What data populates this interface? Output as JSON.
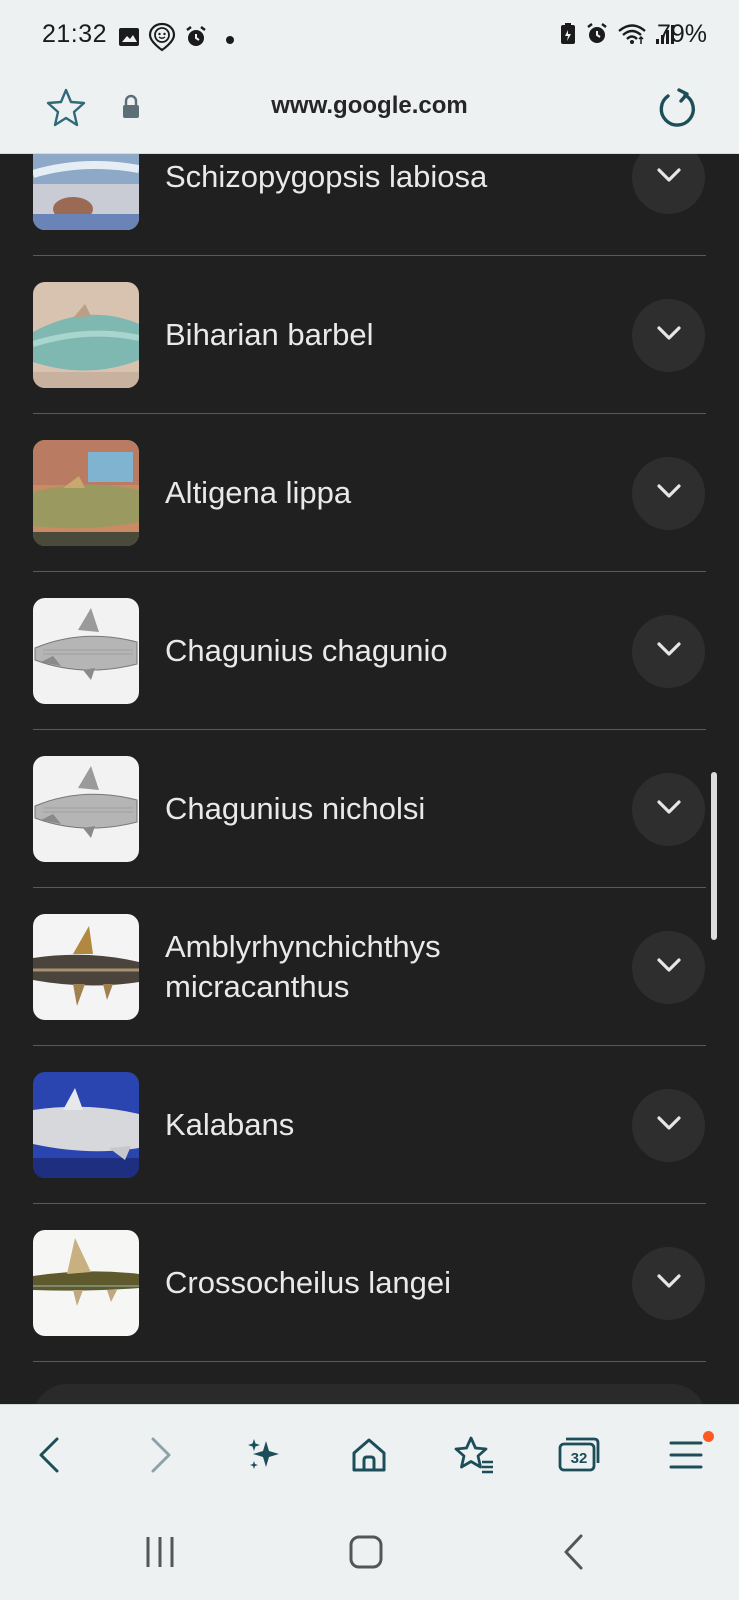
{
  "status_bar": {
    "time": "21:32",
    "battery": "79%",
    "left_icons": [
      "gallery-icon",
      "face-location-icon",
      "alarm-icon",
      "dot-icon"
    ],
    "right_icons": [
      "battery-saver-icon",
      "alarm-icon",
      "wifi-icon",
      "signal-icon",
      "battery-charging-icon"
    ]
  },
  "url_bar": {
    "url": "www.google.com"
  },
  "results": [
    {
      "label": "Schizopygopsis labiosa"
    },
    {
      "label": "Biharian barbel"
    },
    {
      "label": "Altigena lippa"
    },
    {
      "label": "Chagunius chagunio"
    },
    {
      "label": "Chagunius nicholsi"
    },
    {
      "label": "Amblyrhynchichthys micracanthus"
    },
    {
      "label": "Kalabans"
    },
    {
      "label": "Crossocheilus langei"
    }
  ],
  "toolbar": {
    "tabs_count": "32",
    "items": [
      "back-icon",
      "forward-icon",
      "ai-sparkle-icon",
      "home-icon",
      "bookmarks-icon",
      "tabs-icon",
      "menu-icon"
    ]
  },
  "nav_bar": {
    "items": [
      "recents-icon",
      "home-icon",
      "back-icon"
    ]
  },
  "colors": {
    "page_bg": "#202020",
    "chrome_bg": "#eef1f2",
    "icon_teal": "#1c4e5a",
    "divider": "#5a5a5a",
    "expand_btn_bg": "#2e2e2e",
    "notification_dot": "#ff5a1f"
  }
}
